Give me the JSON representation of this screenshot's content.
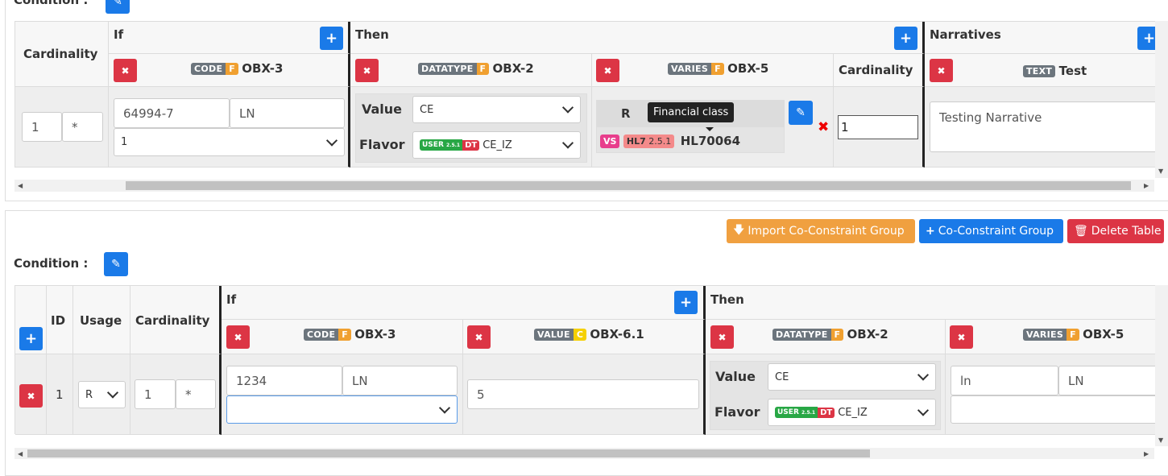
{
  "top": {
    "condition_label": "Condition :",
    "headers": {
      "cardinality": "Cardinality",
      "if": "If",
      "then": "Then",
      "narratives": "Narratives",
      "cardinality2": "Cardinality"
    },
    "if_col": {
      "badge": "CODE",
      "flag": "F",
      "field": "OBX-3"
    },
    "then_col1": {
      "badge": "DATATYPE",
      "flag": "F",
      "field": "OBX-2"
    },
    "then_col2": {
      "badge": "VARIES",
      "flag": "F",
      "field": "OBX-5"
    },
    "narr_col": {
      "badge": "TEXT",
      "field": "Test"
    },
    "row": {
      "card_min": "1",
      "card_max": "*",
      "code_value": "64994-7",
      "code_system": "LN",
      "code_select": "1",
      "value_label": "Value",
      "value_select": "CE",
      "flavor_label": "Flavor",
      "flavor_user": "USER",
      "flavor_user_ver": "2.5.1",
      "flavor_dt": "DT",
      "flavor_select": "CE_IZ",
      "vs_usage": "R",
      "tooltip": "Financial class",
      "vs_badge": "VS",
      "hl7_badge": "HL7",
      "hl7_ver": "2.5.1",
      "vs_id": "HL70064",
      "cardinality_value": "1",
      "narrative_text": "Testing Narrative"
    }
  },
  "bottom": {
    "buttons": {
      "import": "Import Co-Constraint Group",
      "add_group": "Co-Constraint Group",
      "delete": "Delete Table"
    },
    "condition_label": "Condition :",
    "headers": {
      "id": "ID",
      "usage": "Usage",
      "cardinality": "Cardinality",
      "if": "If",
      "then": "Then"
    },
    "if_col1": {
      "badge": "CODE",
      "flag": "F",
      "field": "OBX-3"
    },
    "if_col2": {
      "badge": "VALUE",
      "flag": "C",
      "field": "OBX-6.1"
    },
    "then_col1": {
      "badge": "DATATYPE",
      "flag": "F",
      "field": "OBX-2"
    },
    "then_col2": {
      "badge": "VARIES",
      "flag": "F",
      "field": "OBX-5"
    },
    "row": {
      "id": "1",
      "usage": "R",
      "card_min": "1",
      "card_max": "*",
      "code_value": "1234",
      "code_system": "LN",
      "value": "5",
      "value_label": "Value",
      "value_select": "CE",
      "flavor_label": "Flavor",
      "flavor_user": "USER",
      "flavor_user_ver": "2.5.1",
      "flavor_dt": "DT",
      "flavor_select": "CE_IZ",
      "varies_value": "ln",
      "varies_system": "LN"
    }
  }
}
